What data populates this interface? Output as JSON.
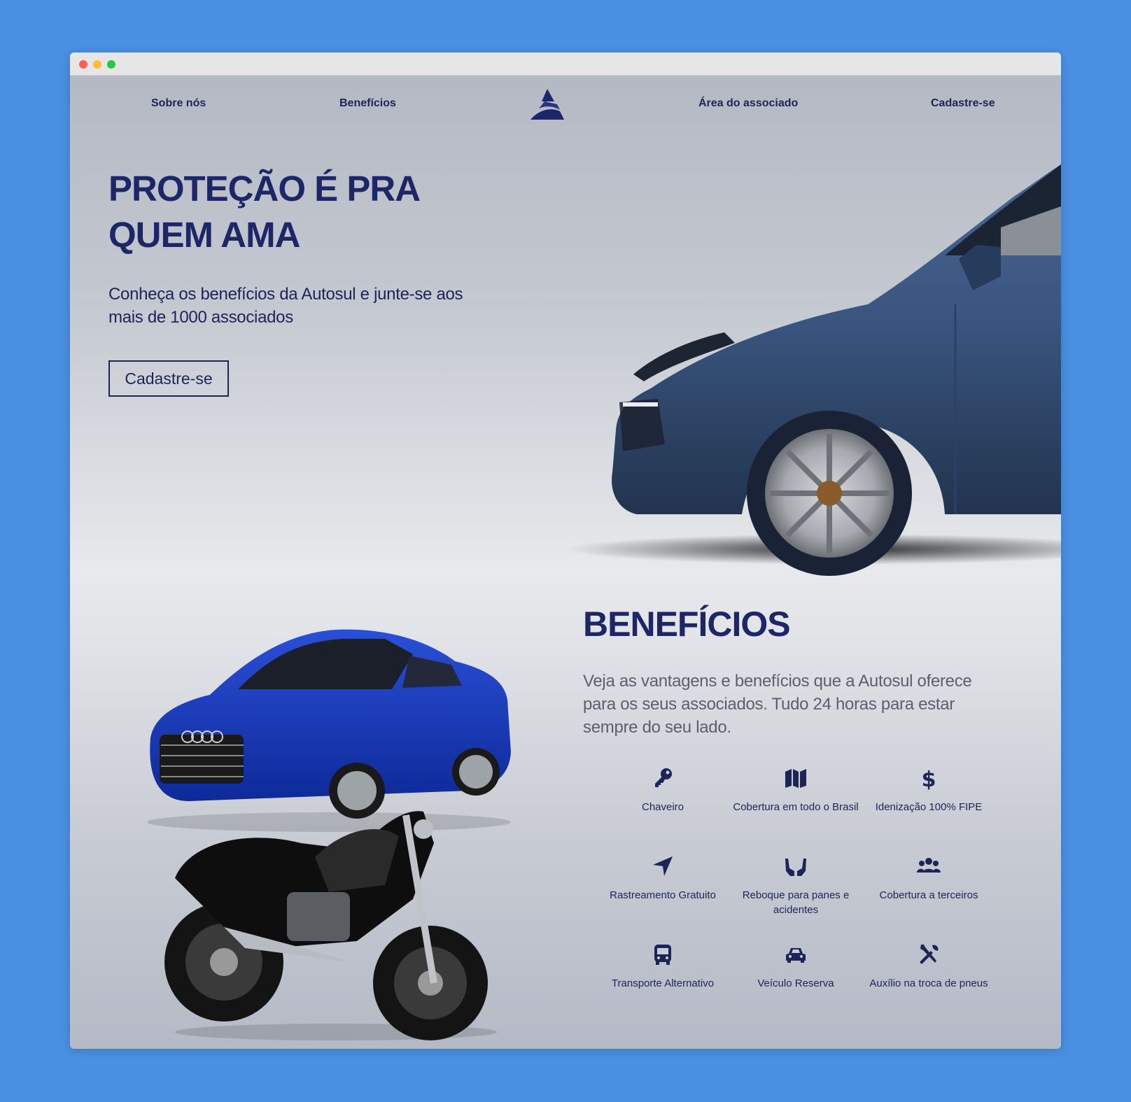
{
  "nav": {
    "about": "Sobre nós",
    "benefits": "Benefícios",
    "member_area": "Área do associado",
    "signup": "Cadastre-se"
  },
  "hero": {
    "title_line1": "PROTEÇÃO É PRA",
    "title_line2": "QUEM AMA",
    "subtitle": "Conheça os benefícios da Autosul e junte-se aos mais de 1000 associados",
    "button": "Cadastre-se"
  },
  "benefits": {
    "title": "BENEFÍCIOS",
    "subtitle": "Veja as vantagens e benefícios que a Autosul oferece para os seus associados. Tudo 24 horas para estar sempre do seu lado.",
    "items": [
      {
        "label": "Chaveiro",
        "icon": "key-icon"
      },
      {
        "label": "Cobertura em todo o Brasil",
        "icon": "map-icon"
      },
      {
        "label": "Idenização 100% FIPE",
        "icon": "dollar-icon"
      },
      {
        "label": "Rastreamento Gratuito",
        "icon": "location-arrow-icon"
      },
      {
        "label": "Reboque para panes e acidentes",
        "icon": "hands-icon"
      },
      {
        "label": "Cobertura a terceiros",
        "icon": "users-icon"
      },
      {
        "label": "Transporte Alternativo",
        "icon": "bus-icon"
      },
      {
        "label": "Veículo Reserva",
        "icon": "car-icon"
      },
      {
        "label": "Auxílio na troca de pneus",
        "icon": "tools-icon"
      }
    ]
  },
  "colors": {
    "accent": "#1d2666",
    "page_bg": "#4a90e2"
  }
}
